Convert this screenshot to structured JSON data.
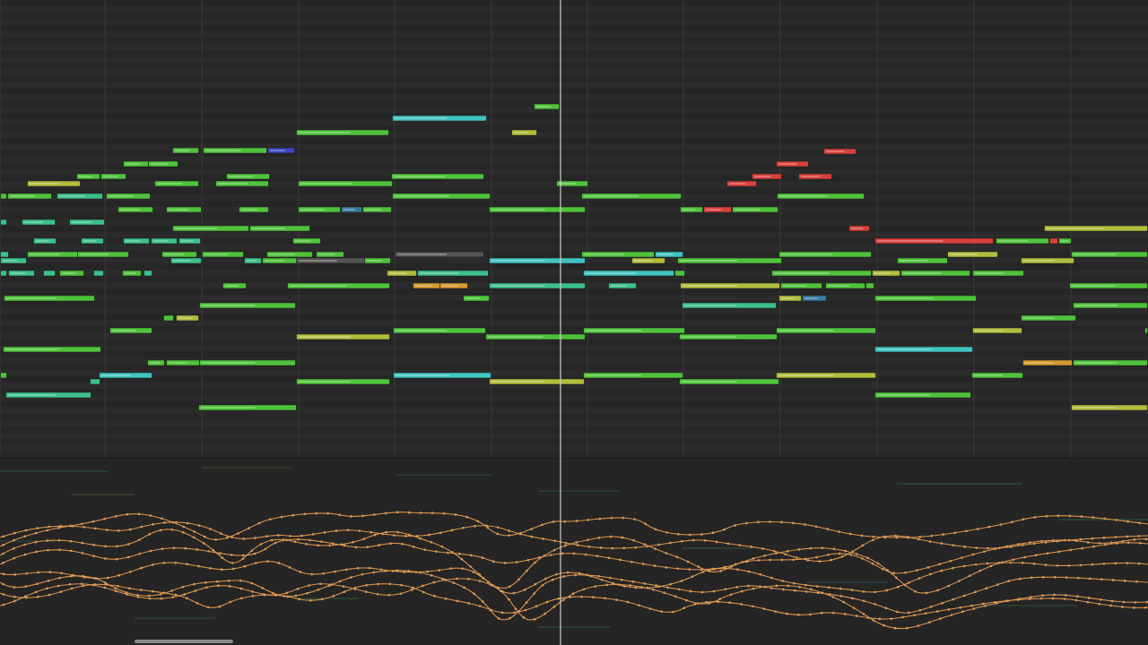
{
  "editor": {
    "view": "piano-roll",
    "colors": {
      "background": "#262626",
      "background_alt": "#2b2b2b",
      "lane_background": "#252525",
      "grid_line": "#2f2f2f",
      "bar_line": "#3a3a3a",
      "playhead": "#cfcfcf",
      "automation_curve": "#e09a52",
      "scrollbar": "#8a8a8a"
    },
    "note_colors": {
      "green": "#4fc23b",
      "teal": "#3cc08a",
      "cyan": "#3fc3c0",
      "yellow": "#b2bc3c",
      "orange": "#d49a32",
      "red": "#d8403c",
      "blue": "#3b46c4",
      "slate": "#3a7aa0",
      "gray": "#555555"
    }
  }
}
